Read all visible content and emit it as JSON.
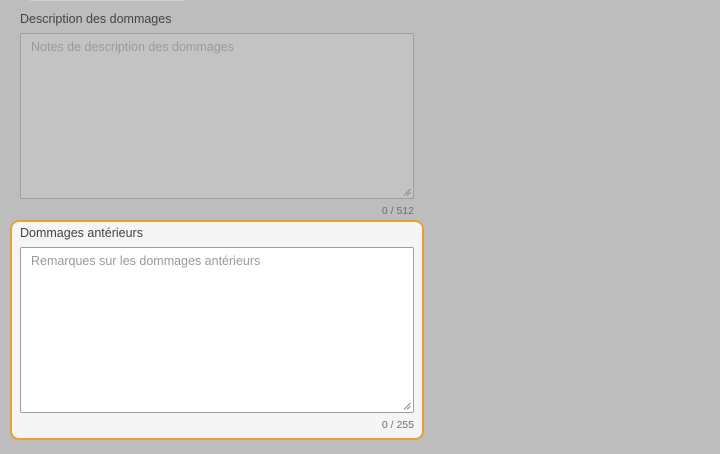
{
  "form": {
    "description": {
      "label": "Description des dommages",
      "placeholder": "Notes de description des dommages",
      "value": "",
      "counter": "0 / 512"
    },
    "prior_damage": {
      "label": "Dommages antérieurs",
      "placeholder": "Remarques sur les dommages antérieurs",
      "value": "",
      "counter": "0 / 255"
    }
  },
  "colors": {
    "background": "#bdbdbd",
    "focus_ring": "#e8a131",
    "focused_panel": "#f5f5f5"
  }
}
